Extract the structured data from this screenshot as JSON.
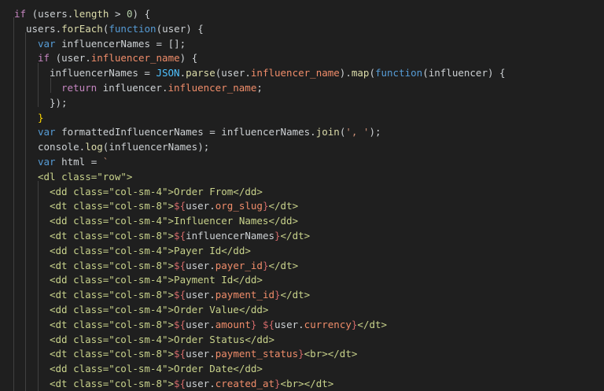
{
  "editor": {
    "lines": [
      {
        "tokens": [
          {
            "t": "if",
            "c": "kw"
          },
          {
            "t": " (users.",
            "c": "plain"
          },
          {
            "t": "length",
            "c": "fn"
          },
          {
            "t": " > ",
            "c": "plain"
          },
          {
            "t": "0",
            "c": "num"
          },
          {
            "t": ") {",
            "c": "plain"
          }
        ]
      },
      {
        "tokens": [
          {
            "t": "users.",
            "c": "plain"
          },
          {
            "t": "forEach",
            "c": "fn"
          },
          {
            "t": "(",
            "c": "plain"
          },
          {
            "t": "function",
            "c": "var"
          },
          {
            "t": "(user) {",
            "c": "plain"
          }
        ]
      },
      {
        "tokens": [
          {
            "t": "var",
            "c": "var"
          },
          {
            "t": " influencerNames = [];",
            "c": "plain"
          }
        ]
      },
      {
        "tokens": [
          {
            "t": "if",
            "c": "kw"
          },
          {
            "t": " (user.",
            "c": "plain"
          },
          {
            "t": "influencer_name",
            "c": "prop"
          },
          {
            "t": ") {",
            "c": "plain"
          }
        ]
      },
      {
        "tokens": [
          {
            "t": "influencerNames = ",
            "c": "plain"
          },
          {
            "t": "JSON",
            "c": "const"
          },
          {
            "t": ".",
            "c": "plain"
          },
          {
            "t": "parse",
            "c": "fn"
          },
          {
            "t": "(user.",
            "c": "plain"
          },
          {
            "t": "influencer_name",
            "c": "prop"
          },
          {
            "t": ").",
            "c": "plain"
          },
          {
            "t": "map",
            "c": "fn"
          },
          {
            "t": "(",
            "c": "plain"
          },
          {
            "t": "function",
            "c": "var"
          },
          {
            "t": "(influencer) {",
            "c": "plain"
          }
        ]
      },
      {
        "tokens": [
          {
            "t": "return",
            "c": "kw"
          },
          {
            "t": " influencer.",
            "c": "plain"
          },
          {
            "t": "influencer_name",
            "c": "prop"
          },
          {
            "t": ";",
            "c": "plain"
          }
        ]
      },
      {
        "tokens": [
          {
            "t": "});",
            "c": "plain"
          }
        ]
      },
      {
        "tokens": [
          {
            "t": "}",
            "c": "brace"
          }
        ]
      },
      {
        "tokens": [
          {
            "t": "var",
            "c": "var"
          },
          {
            "t": " formattedInfluencerNames = influencerNames.",
            "c": "plain"
          },
          {
            "t": "join",
            "c": "fn"
          },
          {
            "t": "(",
            "c": "plain"
          },
          {
            "t": "', '",
            "c": "str"
          },
          {
            "t": ");",
            "c": "plain"
          }
        ]
      },
      {
        "tokens": [
          {
            "t": "console.",
            "c": "plain"
          },
          {
            "t": "log",
            "c": "fn"
          },
          {
            "t": "(influencerNames);",
            "c": "plain"
          }
        ]
      },
      {
        "tokens": [
          {
            "t": "var",
            "c": "var"
          },
          {
            "t": " html = ",
            "c": "plain"
          },
          {
            "t": "`",
            "c": "str"
          }
        ]
      },
      {
        "tokens": [
          {
            "t": "<dl class=\"row\">",
            "c": "html"
          }
        ]
      },
      {
        "tokens": [
          {
            "t": "<dd class=\"col-sm-4\">Order From</dd>",
            "c": "html"
          }
        ]
      },
      {
        "tokens": [
          {
            "t": "<dt class=\"col-sm-8\">",
            "c": "html"
          },
          {
            "t": "${",
            "c": "interp"
          },
          {
            "t": "user.",
            "c": "plain"
          },
          {
            "t": "org_slug",
            "c": "prop"
          },
          {
            "t": "}",
            "c": "interp"
          },
          {
            "t": "</dt>",
            "c": "html"
          }
        ]
      },
      {
        "tokens": [
          {
            "t": "<dd class=\"col-sm-4\">Influencer Names</dd>",
            "c": "html"
          }
        ]
      },
      {
        "tokens": [
          {
            "t": "<dt class=\"col-sm-8\">",
            "c": "html"
          },
          {
            "t": "${",
            "c": "interp"
          },
          {
            "t": "influencerNames",
            "c": "plain"
          },
          {
            "t": "}",
            "c": "interp"
          },
          {
            "t": "</dt>",
            "c": "html"
          }
        ]
      },
      {
        "tokens": [
          {
            "t": "<dd class=\"col-sm-4\">Payer Id</dd>",
            "c": "html"
          }
        ]
      },
      {
        "tokens": [
          {
            "t": "<dt class=\"col-sm-8\">",
            "c": "html"
          },
          {
            "t": "${",
            "c": "interp"
          },
          {
            "t": "user.",
            "c": "plain"
          },
          {
            "t": "payer_id",
            "c": "prop"
          },
          {
            "t": "}",
            "c": "interp"
          },
          {
            "t": "</dt>",
            "c": "html"
          }
        ]
      },
      {
        "tokens": [
          {
            "t": "<dd class=\"col-sm-4\">Payment Id</dd>",
            "c": "html"
          }
        ]
      },
      {
        "tokens": [
          {
            "t": "<dt class=\"col-sm-8\">",
            "c": "html"
          },
          {
            "t": "${",
            "c": "interp"
          },
          {
            "t": "user.",
            "c": "plain"
          },
          {
            "t": "payment_id",
            "c": "prop"
          },
          {
            "t": "}",
            "c": "interp"
          },
          {
            "t": "</dt>",
            "c": "html"
          }
        ]
      },
      {
        "tokens": [
          {
            "t": "<dd class=\"col-sm-4\">Order Value</dd>",
            "c": "html"
          }
        ]
      },
      {
        "tokens": [
          {
            "t": "<dt class=\"col-sm-8\">",
            "c": "html"
          },
          {
            "t": "${",
            "c": "interp"
          },
          {
            "t": "user.",
            "c": "plain"
          },
          {
            "t": "amount",
            "c": "prop"
          },
          {
            "t": "}",
            "c": "interp"
          },
          {
            "t": " ",
            "c": "plain"
          },
          {
            "t": "${",
            "c": "interp"
          },
          {
            "t": "user.",
            "c": "plain"
          },
          {
            "t": "currency",
            "c": "prop"
          },
          {
            "t": "}",
            "c": "interp"
          },
          {
            "t": "</dt>",
            "c": "html"
          }
        ]
      },
      {
        "tokens": [
          {
            "t": "<dd class=\"col-sm-4\">Order Status</dd>",
            "c": "html"
          }
        ]
      },
      {
        "tokens": [
          {
            "t": "<dt class=\"col-sm-8\">",
            "c": "html"
          },
          {
            "t": "${",
            "c": "interp"
          },
          {
            "t": "user.",
            "c": "plain"
          },
          {
            "t": "payment_status",
            "c": "prop"
          },
          {
            "t": "}",
            "c": "interp"
          },
          {
            "t": "<br></dt>",
            "c": "html"
          }
        ]
      },
      {
        "tokens": [
          {
            "t": "<dd class=\"col-sm-4\">Order Date</dd>",
            "c": "html"
          }
        ]
      },
      {
        "tokens": [
          {
            "t": "<dt class=\"col-sm-8\">",
            "c": "html"
          },
          {
            "t": "${",
            "c": "interp"
          },
          {
            "t": "user.",
            "c": "plain"
          },
          {
            "t": "created_at",
            "c": "prop"
          },
          {
            "t": "}",
            "c": "interp"
          },
          {
            "t": "<br></dt>",
            "c": "html"
          }
        ]
      }
    ]
  },
  "colors": {
    "background": "#1f1f1f",
    "keyword": "#c586c0",
    "storage": "#569cd6",
    "function": "#dcdcaa",
    "property": "#f08d6a",
    "string": "#ce9178",
    "number": "#b5cea8",
    "text": "#cdd1d4",
    "constant": "#4fc1ff",
    "interpolation": "#d16969",
    "html": "#c8d28b"
  }
}
